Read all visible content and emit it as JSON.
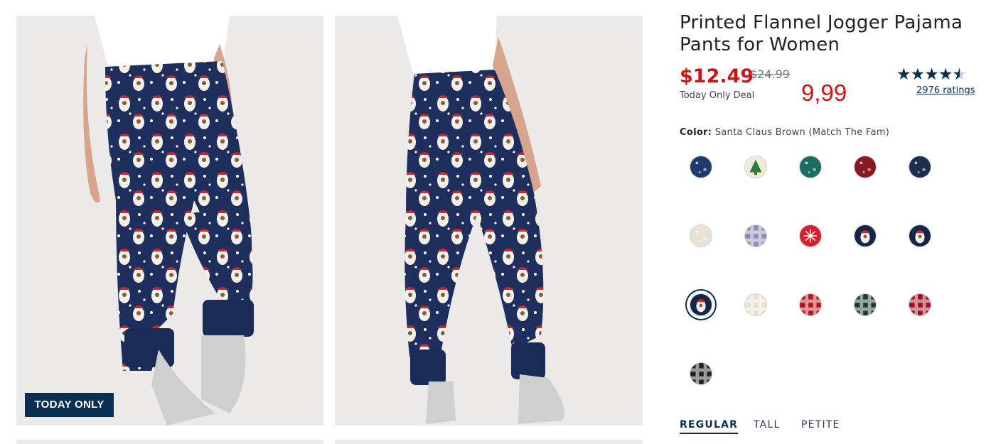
{
  "product": {
    "title": "Printed Flannel Jogger Pajama Pants for Women",
    "sale_price": "$12.49",
    "original_price": "$24.99",
    "deal_label": "Today Only Deal",
    "alt_price": "9,99",
    "rating": 4.5,
    "ratings_text": "2976 ratings"
  },
  "gallery": {
    "badge": "TODAY ONLY"
  },
  "color": {
    "label": "Color:",
    "value": "Santa Claus Brown (Match The Fam)"
  },
  "swatches": [
    {
      "name": "navy-print",
      "color": "#1f3a6b"
    },
    {
      "name": "christmas-tree",
      "color": "#e8ecd9"
    },
    {
      "name": "teal-ornament",
      "color": "#1b6b63"
    },
    {
      "name": "red-print",
      "color": "#8a1a22"
    },
    {
      "name": "navy-script",
      "color": "#1c2f4d"
    },
    {
      "name": "cream-print",
      "color": "#e9e2d7"
    },
    {
      "name": "plaid-lavender",
      "color": "#8c8fb0"
    },
    {
      "name": "red-snowflake",
      "color": "#d91f2b"
    },
    {
      "name": "santa-navy",
      "color": "#14274a"
    },
    {
      "name": "santa-navy-2",
      "color": "#14274a"
    },
    {
      "name": "santa-claus-brown",
      "color": "#14274a",
      "selected": true
    },
    {
      "name": "cream-plaid",
      "color": "#e8e0d0"
    },
    {
      "name": "red-plaid",
      "color": "#b5121b"
    },
    {
      "name": "green-plaid",
      "color": "#1b3b33"
    },
    {
      "name": "buffalo-check",
      "color": "#a10e1f"
    },
    {
      "name": "black-white-check",
      "color": "#222222"
    }
  ],
  "fit_tabs": [
    "REGULAR",
    "TALL",
    "PETITE"
  ]
}
